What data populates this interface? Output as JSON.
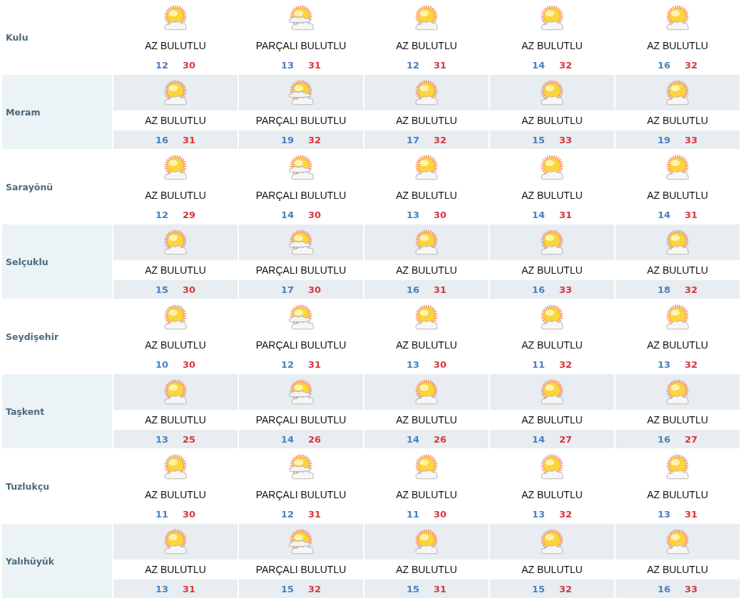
{
  "districts": [
    {
      "name": "Kulu",
      "days": [
        {
          "kind": "few_clouds",
          "condition": "AZ BULUTLU",
          "low": "12",
          "high": "30"
        },
        {
          "kind": "partly_cloudy",
          "condition": "PARÇALI BULUTLU",
          "low": "13",
          "high": "31"
        },
        {
          "kind": "few_clouds",
          "condition": "AZ BULUTLU",
          "low": "12",
          "high": "31"
        },
        {
          "kind": "few_clouds",
          "condition": "AZ BULUTLU",
          "low": "14",
          "high": "32"
        },
        {
          "kind": "few_clouds",
          "condition": "AZ BULUTLU",
          "low": "16",
          "high": "32"
        }
      ]
    },
    {
      "name": "Meram",
      "days": [
        {
          "kind": "few_clouds",
          "condition": "AZ BULUTLU",
          "low": "16",
          "high": "31"
        },
        {
          "kind": "partly_cloudy",
          "condition": "PARÇALI BULUTLU",
          "low": "19",
          "high": "32"
        },
        {
          "kind": "few_clouds",
          "condition": "AZ BULUTLU",
          "low": "17",
          "high": "32"
        },
        {
          "kind": "few_clouds",
          "condition": "AZ BULUTLU",
          "low": "15",
          "high": "33"
        },
        {
          "kind": "few_clouds",
          "condition": "AZ BULUTLU",
          "low": "19",
          "high": "33"
        }
      ]
    },
    {
      "name": "Sarayönü",
      "days": [
        {
          "kind": "few_clouds",
          "condition": "AZ BULUTLU",
          "low": "12",
          "high": "29"
        },
        {
          "kind": "partly_cloudy",
          "condition": "PARÇALI BULUTLU",
          "low": "14",
          "high": "30"
        },
        {
          "kind": "few_clouds",
          "condition": "AZ BULUTLU",
          "low": "13",
          "high": "30"
        },
        {
          "kind": "few_clouds",
          "condition": "AZ BULUTLU",
          "low": "14",
          "high": "31"
        },
        {
          "kind": "few_clouds",
          "condition": "AZ BULUTLU",
          "low": "14",
          "high": "31"
        }
      ]
    },
    {
      "name": "Selçuklu",
      "days": [
        {
          "kind": "few_clouds",
          "condition": "AZ BULUTLU",
          "low": "15",
          "high": "30"
        },
        {
          "kind": "partly_cloudy",
          "condition": "PARÇALI BULUTLU",
          "low": "17",
          "high": "30"
        },
        {
          "kind": "few_clouds",
          "condition": "AZ BULUTLU",
          "low": "16",
          "high": "31"
        },
        {
          "kind": "few_clouds",
          "condition": "AZ BULUTLU",
          "low": "16",
          "high": "33"
        },
        {
          "kind": "few_clouds",
          "condition": "AZ BULUTLU",
          "low": "18",
          "high": "32"
        }
      ]
    },
    {
      "name": "Seydişehir",
      "days": [
        {
          "kind": "few_clouds",
          "condition": "AZ BULUTLU",
          "low": "10",
          "high": "30"
        },
        {
          "kind": "partly_cloudy",
          "condition": "PARÇALI BULUTLU",
          "low": "12",
          "high": "31"
        },
        {
          "kind": "few_clouds",
          "condition": "AZ BULUTLU",
          "low": "13",
          "high": "30"
        },
        {
          "kind": "few_clouds",
          "condition": "AZ BULUTLU",
          "low": "11",
          "high": "32"
        },
        {
          "kind": "few_clouds",
          "condition": "AZ BULUTLU",
          "low": "13",
          "high": "32"
        }
      ]
    },
    {
      "name": "Taşkent",
      "days": [
        {
          "kind": "few_clouds",
          "condition": "AZ BULUTLU",
          "low": "13",
          "high": "25"
        },
        {
          "kind": "partly_cloudy",
          "condition": "PARÇALI BULUTLU",
          "low": "14",
          "high": "26"
        },
        {
          "kind": "few_clouds",
          "condition": "AZ BULUTLU",
          "low": "14",
          "high": "26"
        },
        {
          "kind": "few_clouds",
          "condition": "AZ BULUTLU",
          "low": "14",
          "high": "27"
        },
        {
          "kind": "few_clouds",
          "condition": "AZ BULUTLU",
          "low": "16",
          "high": "27"
        }
      ]
    },
    {
      "name": "Tuzlukçu",
      "days": [
        {
          "kind": "few_clouds",
          "condition": "AZ BULUTLU",
          "low": "11",
          "high": "30"
        },
        {
          "kind": "partly_cloudy",
          "condition": "PARÇALI BULUTLU",
          "low": "12",
          "high": "31"
        },
        {
          "kind": "few_clouds",
          "condition": "AZ BULUTLU",
          "low": "11",
          "high": "30"
        },
        {
          "kind": "few_clouds",
          "condition": "AZ BULUTLU",
          "low": "13",
          "high": "32"
        },
        {
          "kind": "few_clouds",
          "condition": "AZ BULUTLU",
          "low": "13",
          "high": "31"
        }
      ]
    },
    {
      "name": "Yalıhüyük",
      "days": [
        {
          "kind": "few_clouds",
          "condition": "AZ BULUTLU",
          "low": "13",
          "high": "31"
        },
        {
          "kind": "partly_cloudy",
          "condition": "PARÇALI BULUTLU",
          "low": "15",
          "high": "32"
        },
        {
          "kind": "few_clouds",
          "condition": "AZ BULUTLU",
          "low": "15",
          "high": "31"
        },
        {
          "kind": "few_clouds",
          "condition": "AZ BULUTLU",
          "low": "15",
          "high": "32"
        },
        {
          "kind": "few_clouds",
          "condition": "AZ BULUTLU",
          "low": "16",
          "high": "33"
        }
      ]
    }
  ]
}
